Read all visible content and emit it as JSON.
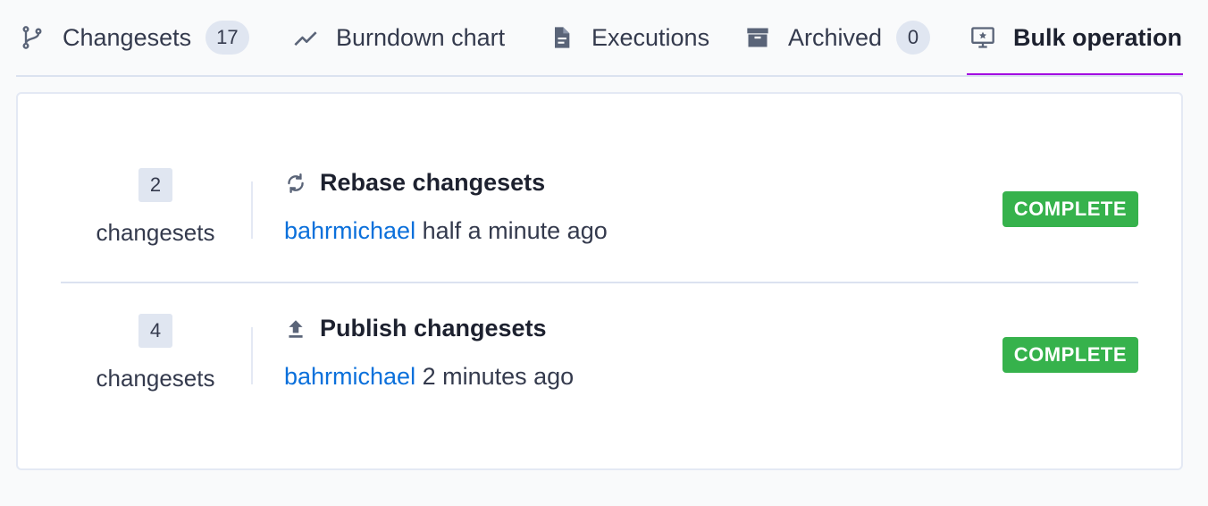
{
  "tabs": [
    {
      "label": "Changesets",
      "badge": "17",
      "icon": "branch-icon"
    },
    {
      "label": "Burndown chart",
      "icon": "chart-line-icon"
    },
    {
      "label": "Executions",
      "icon": "file-document-icon"
    },
    {
      "label": "Archived",
      "badge": "0",
      "icon": "archive-icon"
    },
    {
      "label": "Bulk operations",
      "icon": "monitor-star-icon",
      "active": true
    }
  ],
  "operations": [
    {
      "count": "2",
      "count_label": "changesets",
      "title": "Rebase changesets",
      "icon": "sync-icon",
      "user": "bahrmichael",
      "time": "half a minute ago",
      "status": "COMPLETE"
    },
    {
      "count": "4",
      "count_label": "changesets",
      "title": "Publish changesets",
      "icon": "upload-icon",
      "user": "bahrmichael",
      "time": "2 minutes ago",
      "status": "COMPLETE"
    }
  ],
  "colors": {
    "accent": "#a305e1",
    "complete": "#36b24c",
    "link": "#0b70db"
  }
}
